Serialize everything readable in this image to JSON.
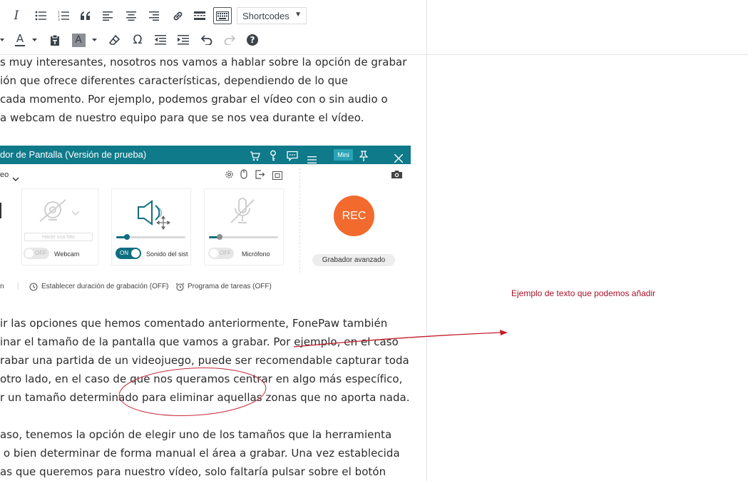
{
  "toolbar": {
    "shortcodes_label": "Shortcodes",
    "shortcodes_caret": "▼",
    "italic_glyph": "I",
    "text_color_glyph": "A",
    "bg_color_glyph": "A",
    "omega_glyph": "Ω",
    "help_glyph": "?"
  },
  "paragraphs": {
    "p1": [
      "s muy interesantes, nosotros nos vamos a hablar sobre la opción de grabar",
      "ión que ofrece diferentes características, dependiendo de lo que",
      "cada momento. Por ejemplo, podemos grabar el vídeo con o sin audio o",
      "a webcam de nuestro equipo para que se nos vea durante el vídeo."
    ],
    "p2": [
      "ir las opciones que hemos comentado anteriormente, FonePaw también",
      "inar el tamaño de la pantalla que vamos a grabar. Por ejemplo, en el caso",
      "rabar una partida de un videojuego, puede ser recomendable capturar toda",
      "otro lado, en el caso de que nos queramos centrar en algo más específico,",
      "r un tamaño determinado para eliminar aquellas zonas que no aporta nada."
    ],
    "p3": [
      "aso, tenemos la opción de elegir uno de los tamaños que la herramienta",
      " o bien determinar de forma manual el área a grabar. Una vez establecida",
      "as que queremos para nuestro vídeo, solo faltaría pulsar sobre el botón"
    ]
  },
  "app": {
    "title": "dor de Pantalla (Versión de prueba)",
    "mini_label": "Mini",
    "mode_label": "eo",
    "webcam": {
      "toggle": "OFF",
      "label": "Webcam",
      "hint": "Hacer una foto"
    },
    "system_sound": {
      "toggle": "ON",
      "label": "Sonido del sist",
      "level": 0.15
    },
    "microphone": {
      "toggle": "OFF",
      "label": "Micrófono",
      "level": 0.15
    },
    "rec_label": "REC",
    "advanced_label": "Grabador avanzado",
    "bottom_left": "n",
    "duration_label": "Establecer duración de grabación (OFF)",
    "schedule_label": "Programa de tareas (OFF)",
    "separator": "|"
  },
  "annotation": {
    "note_text": "Ejemplo de texto que podemos añadir",
    "note_color": "#a8122a",
    "arrow_color": "#c41f2b"
  },
  "colors": {
    "app_title_bar": "#0f7a8a",
    "rec_button": "#f26a2e",
    "toggle_on": "#0f6f80"
  }
}
